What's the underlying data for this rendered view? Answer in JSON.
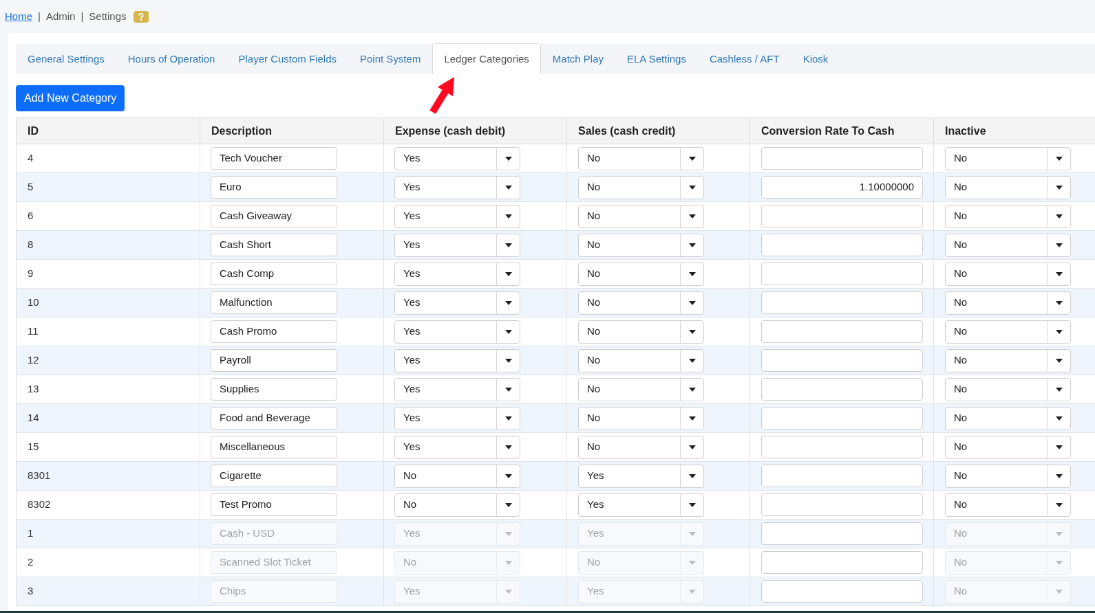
{
  "breadcrumb": {
    "items": [
      {
        "label": "Home",
        "kind": "link"
      },
      {
        "label": "Admin",
        "kind": "text"
      },
      {
        "label": "Settings",
        "kind": "text"
      }
    ],
    "separators": [
      "|",
      "|"
    ]
  },
  "tabs": [
    {
      "label": "General Settings",
      "selected": false
    },
    {
      "label": "Hours of Operation",
      "selected": false
    },
    {
      "label": "Player Custom Fields",
      "selected": false
    },
    {
      "label": "Point System",
      "selected": false
    },
    {
      "label": "Ledger Categories",
      "selected": true
    },
    {
      "label": "Match Play",
      "selected": false
    },
    {
      "label": "ELA Settings",
      "selected": false
    },
    {
      "label": "Cashless / AFT",
      "selected": false
    },
    {
      "label": "Kiosk",
      "selected": false
    }
  ],
  "add_button": {
    "label": "Add New Category"
  },
  "table": {
    "columns": [
      "ID",
      "Description",
      "Expense (cash debit)",
      "Sales (cash credit)",
      "Conversion Rate To Cash",
      "Inactive"
    ],
    "rows": [
      {
        "id": "4",
        "description": "Tech Voucher",
        "expense": "Yes",
        "sales": "No",
        "inactive": "No",
        "disabled": false
      },
      {
        "id": "5",
        "description": "Euro",
        "expense": "Yes",
        "sales": "No",
        "conversion_rate": "1.10000000",
        "inactive": "No",
        "disabled": false
      },
      {
        "id": "6",
        "description": "Cash Giveaway",
        "expense": "Yes",
        "sales": "No",
        "inactive": "No",
        "disabled": false
      },
      {
        "id": "8",
        "description": "Cash Short",
        "expense": "Yes",
        "sales": "No",
        "inactive": "No",
        "disabled": false
      },
      {
        "id": "9",
        "description": "Cash Comp",
        "expense": "Yes",
        "sales": "No",
        "inactive": "No",
        "disabled": false
      },
      {
        "id": "10",
        "description": "Malfunction",
        "expense": "Yes",
        "sales": "No",
        "inactive": "No",
        "disabled": false
      },
      {
        "id": "11",
        "description": "Cash Promo",
        "expense": "Yes",
        "sales": "No",
        "inactive": "No",
        "disabled": false
      },
      {
        "id": "12",
        "description": "Payroll",
        "expense": "Yes",
        "sales": "No",
        "inactive": "No",
        "disabled": false
      },
      {
        "id": "13",
        "description": "Supplies",
        "expense": "Yes",
        "sales": "No",
        "inactive": "No",
        "disabled": false
      },
      {
        "id": "14",
        "description": "Food and Beverage",
        "expense": "Yes",
        "sales": "No",
        "inactive": "No",
        "disabled": false
      },
      {
        "id": "15",
        "description": "Miscellaneous",
        "expense": "Yes",
        "sales": "No",
        "inactive": "No",
        "disabled": false
      },
      {
        "id": "8301",
        "description": "Cigarette",
        "expense": "No",
        "sales": "Yes",
        "inactive": "No",
        "disabled": false
      },
      {
        "id": "8302",
        "description": "Test Promo",
        "expense": "No",
        "sales": "Yes",
        "inactive": "No",
        "disabled": false
      },
      {
        "id": "1",
        "description": "Cash - USD",
        "expense": "Yes",
        "sales": "Yes",
        "inactive": "No",
        "disabled": true
      },
      {
        "id": "2",
        "description": "Scanned Slot Ticket",
        "expense": "No",
        "sales": "No",
        "inactive": "No",
        "disabled": true
      },
      {
        "id": "3",
        "description": "Chips",
        "expense": "Yes",
        "sales": "Yes",
        "inactive": "No",
        "disabled": true
      }
    ]
  }
}
